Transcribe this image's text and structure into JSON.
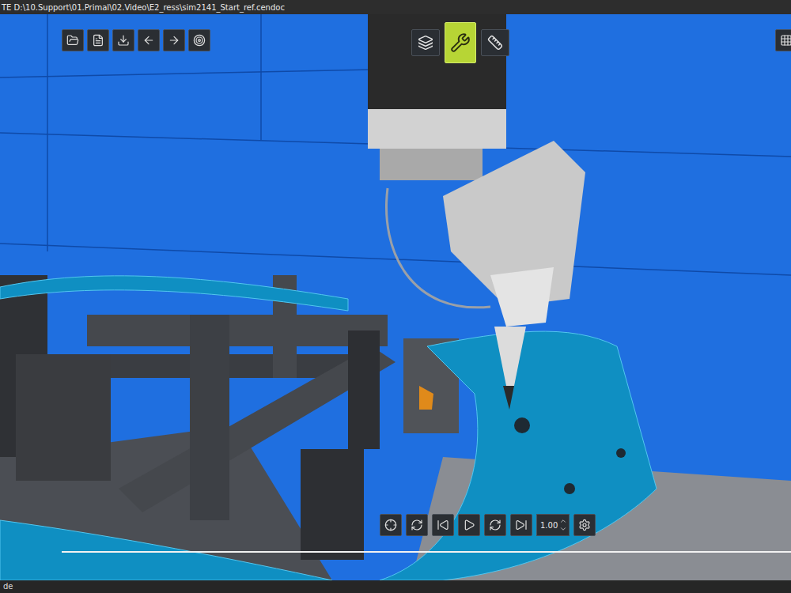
{
  "window": {
    "title": "TE D:\\10.Support\\01.Primal\\02.Video\\E2_ress\\sim2141_Start_ref.cendoc"
  },
  "top_toolbar": [
    {
      "selected": false
    },
    {
      "selected": true
    },
    {
      "selected": false
    }
  ],
  "playback": {
    "speed": "1.00"
  },
  "status_bar": {
    "text": "de"
  }
}
